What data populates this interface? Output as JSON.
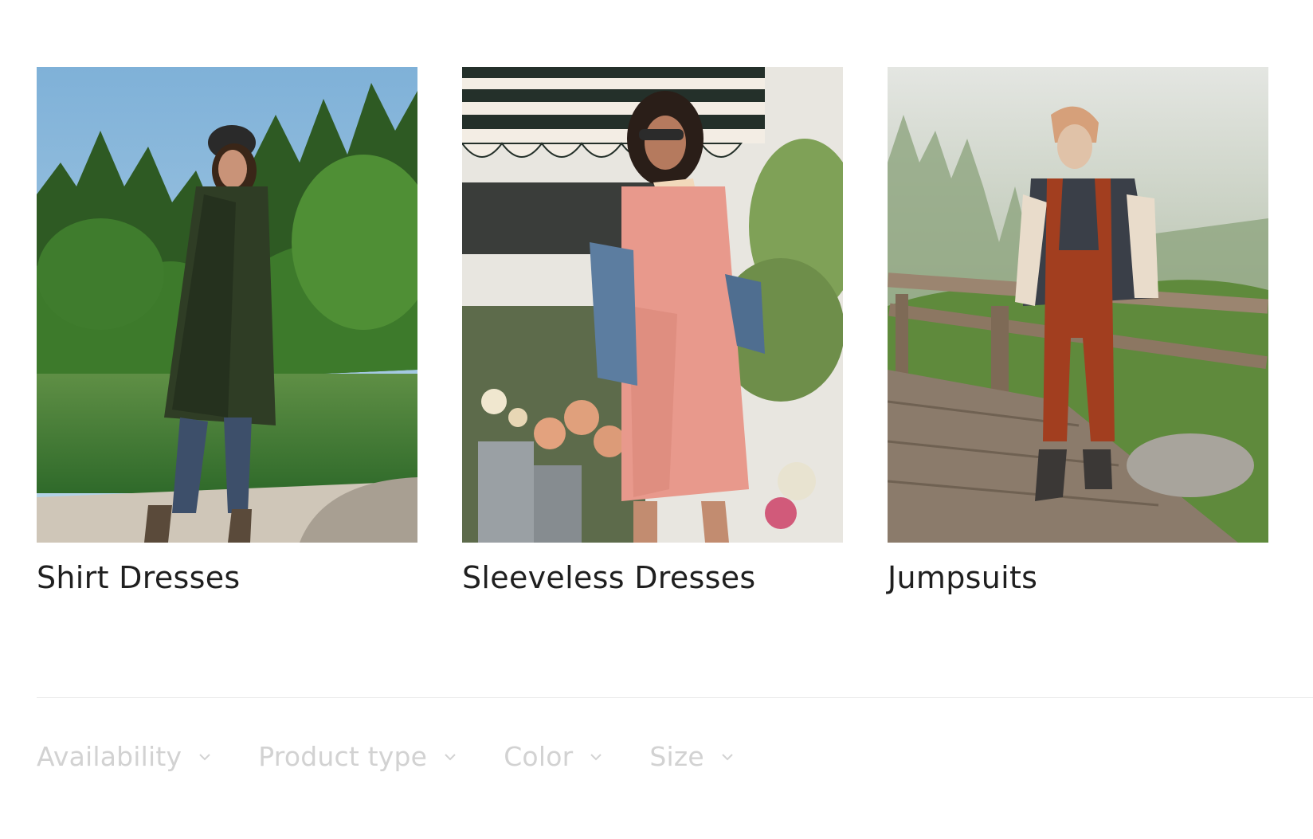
{
  "collections": [
    {
      "title": "Shirt Dresses",
      "image_icon": "woman-plaid-shirt-dress-lakeside-photo"
    },
    {
      "title": "Sleeveless Dresses",
      "image_icon": "woman-pink-sleeveless-dress-flower-stand-photo"
    },
    {
      "title": "Jumpsuits",
      "image_icon": "woman-rust-overalls-forest-boardwalk-photo"
    }
  ],
  "filters": [
    {
      "label": "Availability"
    },
    {
      "label": "Product type"
    },
    {
      "label": "Color"
    },
    {
      "label": "Size"
    }
  ],
  "colors": {
    "title_text": "#1f1f1f",
    "filter_text": "#d2d2d2",
    "divider": "#ececec"
  }
}
